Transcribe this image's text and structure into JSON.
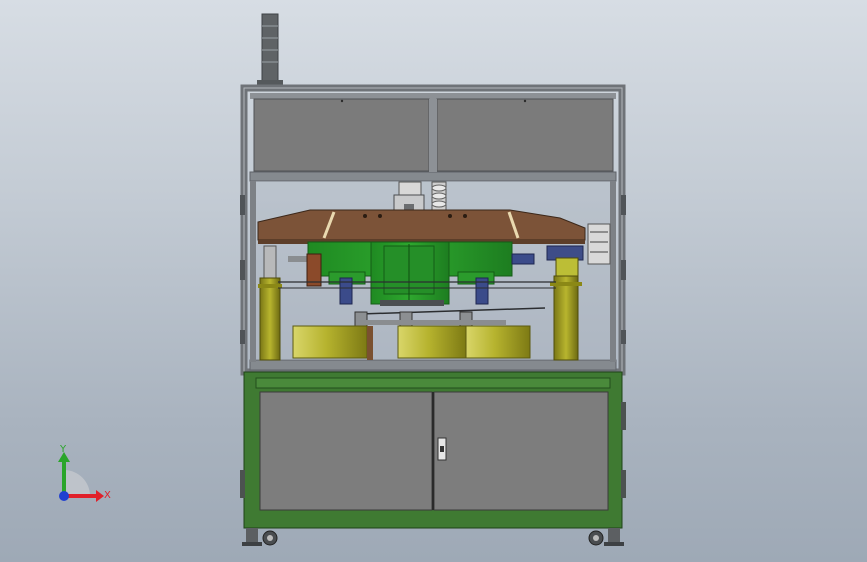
{
  "view": {
    "colors": {
      "frame": "#6f7378",
      "frame_light": "#a4a8ad",
      "panel": "#7b7b7b",
      "base_green": "#3f7a32",
      "assembly_green": "#2f9a2f",
      "wood": "#7c5338",
      "olive": "#b7b22a",
      "column": "#a8a524",
      "navy": "#3b4b8a"
    },
    "triad": {
      "x_label": "X",
      "y_label": "Y",
      "x_color": "#e0202a",
      "y_color": "#2aa52a",
      "z_color": "#2040d0"
    }
  }
}
